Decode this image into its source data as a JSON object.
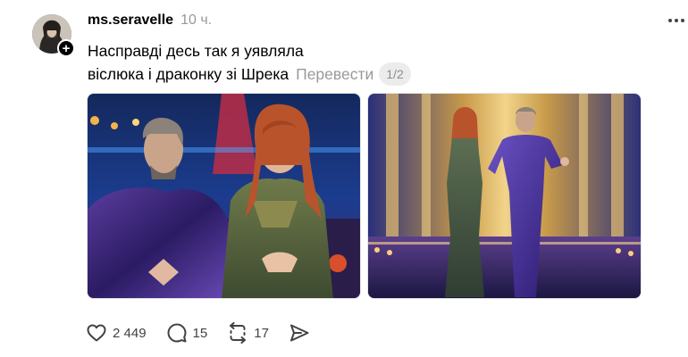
{
  "post": {
    "username": "ms.seravelle",
    "time": "10 ч.",
    "text_line1": "Насправді десь так я уявляла",
    "text_line2": "віслюка і драконку зі Шрека",
    "translate_label": "Перевести",
    "image_counter": "1/2",
    "follow_symbol": "+"
  },
  "actions": {
    "likes": "2 449",
    "comments": "15",
    "reposts": "17"
  },
  "icons": [
    "plus-icon",
    "more-icon",
    "heart-icon",
    "comment-icon",
    "repost-icon",
    "share-icon"
  ]
}
